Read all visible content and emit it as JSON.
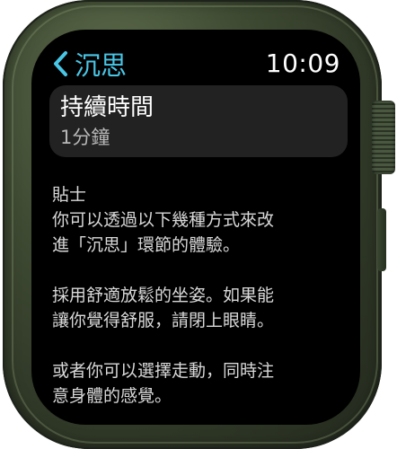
{
  "header": {
    "back_label": "沉思",
    "time": "10:09"
  },
  "duration": {
    "title": "持續時間",
    "value": "1分鐘"
  },
  "tips": {
    "heading": "貼士",
    "intro": "你可以透過以下幾種方式來改\n進「沉思」環節的體驗。",
    "tip1": "採用舒適放鬆的坐姿。如果能\n讓你覺得舒服，請閉上眼睛。",
    "tip2": "或者你可以選擇走動，同時注\n意身體的感覺。"
  },
  "colors": {
    "accent": "#49c6e6",
    "case": "#3f4b33",
    "screen": "#000000",
    "cell": "#222222"
  },
  "icons": {
    "back": "chevron-left-icon"
  }
}
